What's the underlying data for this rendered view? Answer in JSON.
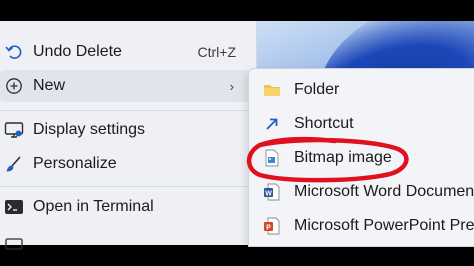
{
  "colors": {
    "menu_bg": "#eef0f6",
    "submenu_bg": "#f3f4f8",
    "highlight_red": "#e0101e",
    "folder_yellow": "#f2c14e"
  },
  "context_menu": {
    "items": [
      {
        "label": "Undo Delete",
        "shortcut": "Ctrl+Z",
        "icon": "undo-icon"
      },
      {
        "label": "New",
        "icon": "plus-circle-icon",
        "has_submenu": true,
        "submenu_arrow": "›"
      },
      {
        "label": "Display settings",
        "icon": "display-icon"
      },
      {
        "label": "Personalize",
        "icon": "brush-icon"
      },
      {
        "label": "Open in Terminal",
        "icon": "terminal-icon"
      }
    ]
  },
  "submenu": {
    "items": [
      {
        "label": "Folder",
        "icon": "folder-icon"
      },
      {
        "label": "Shortcut",
        "icon": "shortcut-arrow-icon"
      },
      {
        "label": "Bitmap image",
        "icon": "bitmap-file-icon",
        "circled": true
      },
      {
        "label": "Microsoft Word Document",
        "icon": "word-document-icon"
      },
      {
        "label": "Microsoft PowerPoint Prese",
        "icon": "powerpoint-document-icon"
      }
    ]
  }
}
